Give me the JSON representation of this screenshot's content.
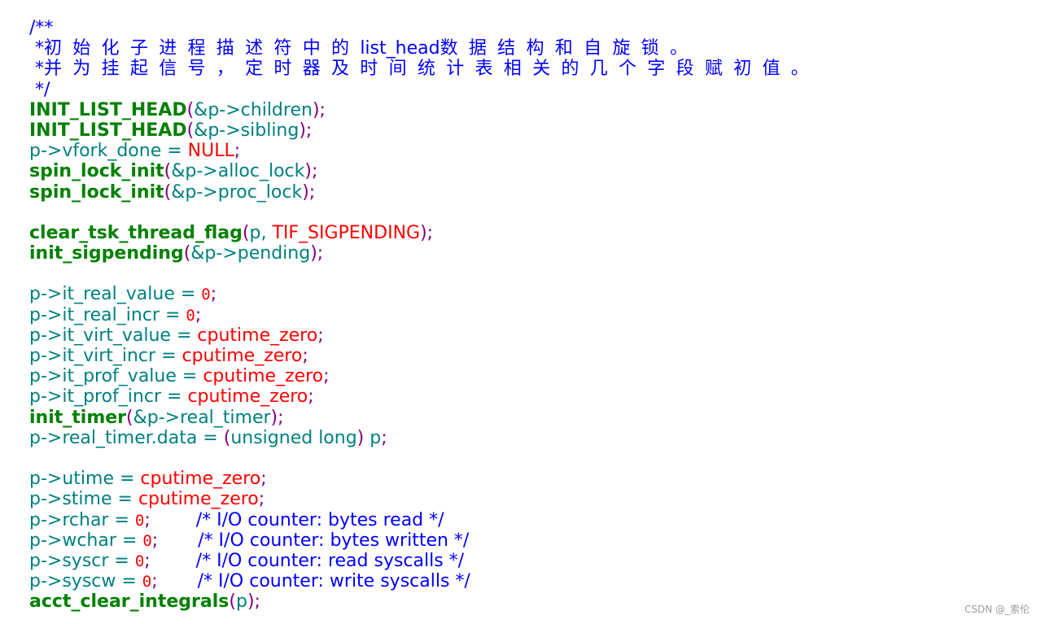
{
  "lines": [
    [
      {
        "t": "/**",
        "k": "cm"
      }
    ],
    [
      {
        "t": " *",
        "k": "cm"
      },
      {
        "t": "初始化子进程描述符中的",
        "k": "cmz"
      },
      {
        "t": "list_head",
        "k": "cm"
      },
      {
        "t": "数据结构和自旋锁。",
        "k": "cmz"
      }
    ],
    [
      {
        "t": " *",
        "k": "cm"
      },
      {
        "t": "并为挂起信号，定时器及时间统计表相关的几个字段赋初值。",
        "k": "cmz"
      }
    ],
    [
      {
        "t": " */",
        "k": "cm"
      }
    ],
    [
      {
        "t": "INIT_LIST_HEAD",
        "k": "fn"
      },
      {
        "t": "(",
        "k": "p"
      },
      {
        "t": "&p->children",
        "k": "v"
      },
      {
        "t": ");",
        "k": "p"
      }
    ],
    [
      {
        "t": "INIT_LIST_HEAD",
        "k": "fn"
      },
      {
        "t": "(",
        "k": "p"
      },
      {
        "t": "&p->sibling",
        "k": "v"
      },
      {
        "t": ");",
        "k": "p"
      }
    ],
    [
      {
        "t": "p->vfork_done = ",
        "k": "v"
      },
      {
        "t": "NULL",
        "k": "c"
      },
      {
        "t": ";",
        "k": "p"
      }
    ],
    [
      {
        "t": "spin_lock_init",
        "k": "fn"
      },
      {
        "t": "(",
        "k": "p"
      },
      {
        "t": "&p->alloc_lock",
        "k": "v"
      },
      {
        "t": ");",
        "k": "p"
      }
    ],
    [
      {
        "t": "spin_lock_init",
        "k": "fn"
      },
      {
        "t": "(",
        "k": "p"
      },
      {
        "t": "&p->proc_lock",
        "k": "v"
      },
      {
        "t": ");",
        "k": "p"
      }
    ],
    [],
    [
      {
        "t": "clear_tsk_thread_flag",
        "k": "fn"
      },
      {
        "t": "(",
        "k": "p"
      },
      {
        "t": "p, ",
        "k": "v"
      },
      {
        "t": "TIF_SIGPENDING",
        "k": "c"
      },
      {
        "t": ");",
        "k": "p"
      }
    ],
    [
      {
        "t": "init_sigpending",
        "k": "fn"
      },
      {
        "t": "(",
        "k": "p"
      },
      {
        "t": "&p->pending",
        "k": "v"
      },
      {
        "t": ");",
        "k": "p"
      }
    ],
    [],
    [
      {
        "t": "p->it_real_value = ",
        "k": "v"
      },
      {
        "t": "0",
        "k": "n"
      },
      {
        "t": ";",
        "k": "p"
      }
    ],
    [
      {
        "t": "p->it_real_incr = ",
        "k": "v"
      },
      {
        "t": "0",
        "k": "n"
      },
      {
        "t": ";",
        "k": "p"
      }
    ],
    [
      {
        "t": "p->it_virt_value = ",
        "k": "v"
      },
      {
        "t": "cputime_zero",
        "k": "c"
      },
      {
        "t": ";",
        "k": "p"
      }
    ],
    [
      {
        "t": "p->it_virt_incr = ",
        "k": "v"
      },
      {
        "t": "cputime_zero",
        "k": "c"
      },
      {
        "t": ";",
        "k": "p"
      }
    ],
    [
      {
        "t": "p->it_prof_value = ",
        "k": "v"
      },
      {
        "t": "cputime_zero",
        "k": "c"
      },
      {
        "t": ";",
        "k": "p"
      }
    ],
    [
      {
        "t": "p->it_prof_incr = ",
        "k": "v"
      },
      {
        "t": "cputime_zero",
        "k": "c"
      },
      {
        "t": ";",
        "k": "p"
      }
    ],
    [
      {
        "t": "init_timer",
        "k": "fn"
      },
      {
        "t": "(",
        "k": "p"
      },
      {
        "t": "&p->real_timer",
        "k": "v"
      },
      {
        "t": ");",
        "k": "p"
      }
    ],
    [
      {
        "t": "p->real_timer.data = ",
        "k": "v"
      },
      {
        "t": "(",
        "k": "p"
      },
      {
        "t": "unsigned long",
        "k": "v"
      },
      {
        "t": ")",
        "k": "p"
      },
      {
        "t": " p",
        "k": "v"
      },
      {
        "t": ";",
        "k": "p"
      }
    ],
    [],
    [
      {
        "t": "p->utime = ",
        "k": "v"
      },
      {
        "t": "cputime_zero",
        "k": "c"
      },
      {
        "t": ";",
        "k": "p"
      }
    ],
    [
      {
        "t": "p->stime = ",
        "k": "v"
      },
      {
        "t": "cputime_zero",
        "k": "c"
      },
      {
        "t": ";",
        "k": "p"
      }
    ],
    [
      {
        "t": "p->rchar = ",
        "k": "v"
      },
      {
        "t": "0",
        "k": "n"
      },
      {
        "t": ";",
        "k": "p"
      },
      {
        "t": "        /* I/O counter: bytes read */",
        "k": "cm"
      }
    ],
    [
      {
        "t": "p->wchar = ",
        "k": "v"
      },
      {
        "t": "0",
        "k": "n"
      },
      {
        "t": ";",
        "k": "p"
      },
      {
        "t": "       /* I/O counter: bytes written */",
        "k": "cm"
      }
    ],
    [
      {
        "t": "p->syscr = ",
        "k": "v"
      },
      {
        "t": "0",
        "k": "n"
      },
      {
        "t": ";",
        "k": "p"
      },
      {
        "t": "        /* I/O counter: read syscalls */",
        "k": "cm"
      }
    ],
    [
      {
        "t": "p->syscw = ",
        "k": "v"
      },
      {
        "t": "0",
        "k": "n"
      },
      {
        "t": ";",
        "k": "p"
      },
      {
        "t": "       /* I/O counter: write syscalls */",
        "k": "cm"
      }
    ],
    [
      {
        "t": "acct_clear_integrals",
        "k": "fn"
      },
      {
        "t": "(",
        "k": "p"
      },
      {
        "t": "p",
        "k": "v"
      },
      {
        "t": ");",
        "k": "p"
      }
    ]
  ],
  "watermark": "CSDN @_索伦"
}
